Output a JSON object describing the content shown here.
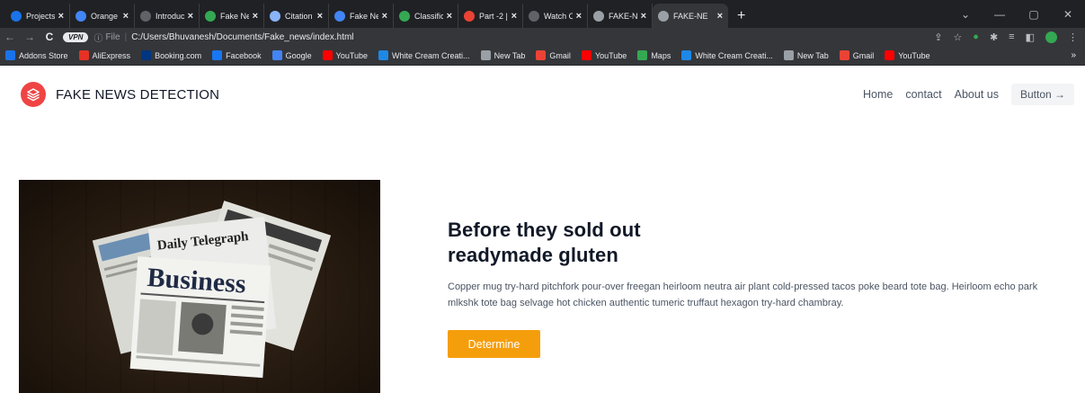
{
  "browser": {
    "tabs": [
      {
        "label": "Projects -",
        "fav_color": "#1a73e8",
        "icon": "projects-icon"
      },
      {
        "label": "Orange a",
        "fav_color": "#4285f4",
        "icon": "orange-icon"
      },
      {
        "label": "Introduct",
        "fav_color": "#5f6368",
        "icon": "introduction-icon"
      },
      {
        "label": "Fake New",
        "fav_color": "#34a853",
        "icon": "fake-news-icon"
      },
      {
        "label": "Citation",
        "fav_color": "#8ab4f8",
        "icon": "cloud-icon"
      },
      {
        "label": "Fake New",
        "fav_color": "#4285f4",
        "icon": "caret-icon"
      },
      {
        "label": "Classifica",
        "fav_color": "#34a853",
        "icon": "classification-icon"
      },
      {
        "label": "Part -2 |",
        "fav_color": "#ea4335",
        "icon": "youtube-icon"
      },
      {
        "label": "Watch O",
        "fav_color": "#5f6368",
        "icon": "watch-icon"
      },
      {
        "label": "FAKE-NE",
        "fav_color": "#9aa0a6",
        "icon": "globe-icon"
      },
      {
        "label": "FAKE-NE",
        "fav_color": "#9aa0a6",
        "icon": "globe-icon",
        "active": true
      }
    ],
    "new_tab_label": "+",
    "vpn_label": "VPN",
    "url_scheme": "File",
    "url": "C:/Users/Bhuvanesh/Documents/Fake_news/index.html",
    "bookmarks": [
      {
        "label": "Addons Store",
        "color": "#1a73e8",
        "icon": "addons-icon"
      },
      {
        "label": "AliExpress",
        "color": "#e43225",
        "icon": "aliexpress-icon"
      },
      {
        "label": "Booking.com",
        "color": "#003580",
        "icon": "booking-icon"
      },
      {
        "label": "Facebook",
        "color": "#1877f2",
        "icon": "facebook-icon"
      },
      {
        "label": "Google",
        "color": "#4285f4",
        "icon": "google-icon"
      },
      {
        "label": "YouTube",
        "color": "#ff0000",
        "icon": "youtube-icon"
      },
      {
        "label": "White Cream Creati...",
        "color": "#1e88e5",
        "icon": "white-cream-icon"
      },
      {
        "label": "New Tab",
        "color": "#9aa0a6",
        "icon": "globe-icon"
      },
      {
        "label": "Gmail",
        "color": "#ea4335",
        "icon": "gmail-icon"
      },
      {
        "label": "YouTube",
        "color": "#ff0000",
        "icon": "youtube-icon"
      },
      {
        "label": "Maps",
        "color": "#34a853",
        "icon": "maps-icon"
      },
      {
        "label": "White Cream Creati...",
        "color": "#1e88e5",
        "icon": "white-cream-icon"
      },
      {
        "label": "New Tab",
        "color": "#9aa0a6",
        "icon": "globe-icon"
      },
      {
        "label": "Gmail",
        "color": "#ea4335",
        "icon": "gmail-icon"
      },
      {
        "label": "YouTube",
        "color": "#ff0000",
        "icon": "youtube-icon"
      }
    ],
    "more_label": "»"
  },
  "header": {
    "brand": "FAKE NEWS DETECTION",
    "nav": [
      "Home",
      "contact",
      "About us"
    ],
    "button_label": "Button →",
    "logo_color": "#ef4444"
  },
  "hero": {
    "title_line1": "Before they sold out",
    "title_line2": "readymade gluten",
    "paragraph": "Copper mug try-hard pitchfork pour-over freegan heirloom neutra air plant cold-pressed tacos poke beard tote bag. Heirloom echo park mlkshk tote bag selvage hot chicken authentic tumeric truffaut hexagon try-hard chambray.",
    "cta_label": "Determine",
    "cta_color": "#f59e0b",
    "image_name": "newspapers-image",
    "image_masthead": "Business",
    "image_masthead_2": "Daily Telegraph"
  }
}
